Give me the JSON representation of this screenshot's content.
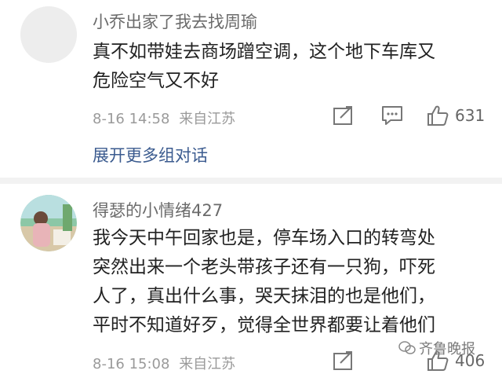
{
  "comments": [
    {
      "username": "小乔出家了我去找周瑜",
      "lines": [
        "真不如带娃去商场蹭空调，这个地下车库又",
        "危险空气又不好"
      ],
      "time": "8-16 14:58",
      "location": "来自江苏",
      "likes": "631",
      "expand_label": "展开更多组对话"
    },
    {
      "username": "得瑟的小情绪427",
      "lines": [
        "我今天中午回家也是，停车场入口的转弯处",
        "突然出来一个老头带孩子还有一只狗，吓死",
        "人了，真出什么事，哭天抹泪的也是他们，",
        "平时不知道好歹，觉得全世界都要让着他们"
      ],
      "time": "8-16 15:08",
      "location": "来自江苏",
      "likes": "406"
    }
  ],
  "watermark": "齐鲁晚报"
}
